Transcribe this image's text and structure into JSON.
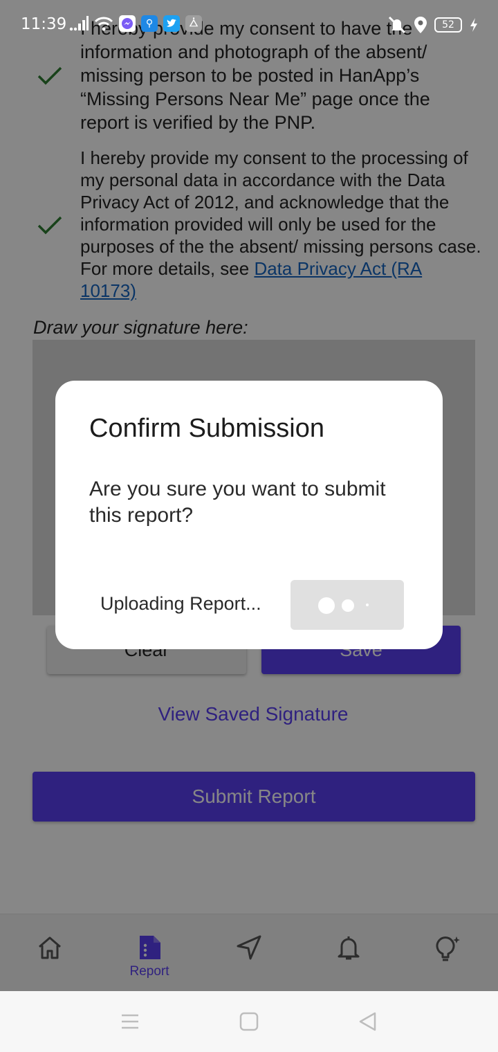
{
  "status_bar": {
    "time": "11:39",
    "battery": "52",
    "left_icons": [
      "signal-icon",
      "wifi-icon",
      "messenger-icon",
      "usb-icon",
      "twitter-icon",
      "app-icon"
    ],
    "right_icons": [
      "mute-icon",
      "location-icon",
      "battery-icon",
      "charging-icon"
    ]
  },
  "consents": [
    {
      "text": "I hereby provide my consent to have the information and photograph of the absent/ missing person to be posted in HanApp’s “Missing Persons Near Me” page once the report is verified by the PNP.",
      "checked": true
    },
    {
      "text": "I hereby provide my consent to the processing of my personal data in accordance with the Data Privacy Act of 2012, and acknowledge that the information provided will only be used for the purposes of the the absent/ missing persons case. For more details, see ",
      "link": "Data Privacy Act (RA 10173)",
      "checked": true
    }
  ],
  "signature": {
    "label": "Draw your signature here:",
    "clear_label": "Clear",
    "save_label": "Save",
    "view_saved_label": "View Saved Signature"
  },
  "submit_label": "Submit Report",
  "dialog": {
    "title": "Confirm Submission",
    "body": "Are you sure you want to submit this report?",
    "status": "Uploading Report..."
  },
  "bottom_nav": {
    "items": [
      {
        "icon": "home-icon",
        "label": ""
      },
      {
        "icon": "report-icon",
        "label": "Report",
        "active": true
      },
      {
        "icon": "send-icon",
        "label": ""
      },
      {
        "icon": "bell-icon",
        "label": ""
      },
      {
        "icon": "lightbulb-icon",
        "label": ""
      }
    ]
  },
  "colors": {
    "accent": "#5a3ff0",
    "check": "#2e7d32",
    "link": "#1565c0",
    "scrim": "rgba(0,0,0,0.47)"
  }
}
